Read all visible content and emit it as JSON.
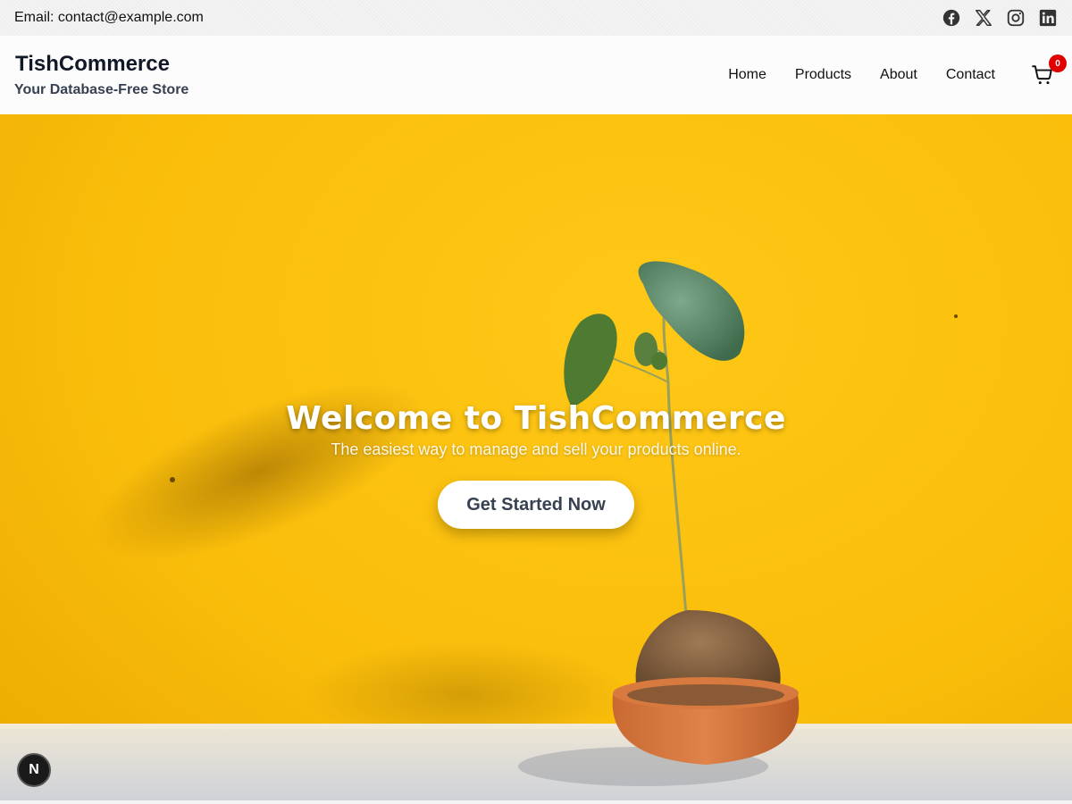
{
  "topbar": {
    "email": "Email: contact@example.com",
    "social": [
      {
        "icon": "facebook-icon"
      },
      {
        "icon": "x-icon"
      },
      {
        "icon": "instagram-icon"
      },
      {
        "icon": "linkedin-icon"
      }
    ]
  },
  "header": {
    "brand_name": "TishCommerce",
    "tagline": "Your Database-Free Store",
    "nav": [
      "Home",
      "Products",
      "About",
      "Contact"
    ],
    "cart_count": "0"
  },
  "hero": {
    "title": "Welcome to TishCommerce",
    "subtitle": "The easiest way to manage and sell your products online.",
    "cta_label": "Get Started Now"
  },
  "fab": {
    "label": "N"
  },
  "colors": {
    "accent_yellow": "#f9bd0a",
    "badge_red": "#e00000",
    "text_dark": "#111827"
  }
}
